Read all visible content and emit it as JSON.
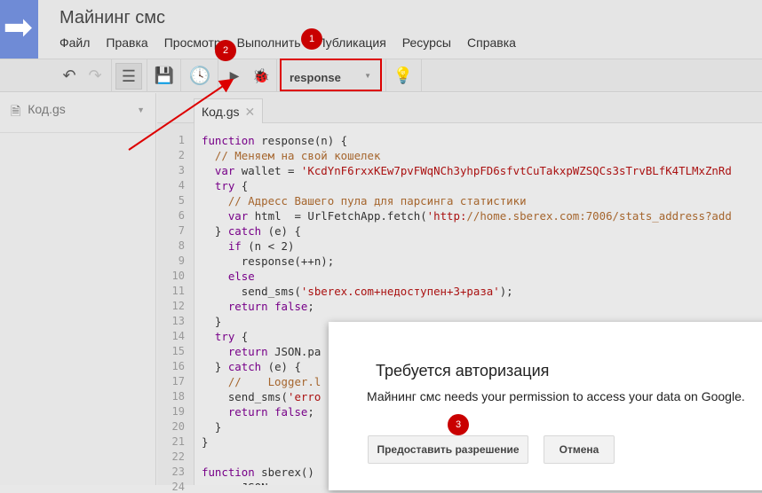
{
  "app": {
    "title": "Майнинг смс",
    "menu": [
      "Файл",
      "Правка",
      "Просмотр",
      "Выполнить",
      "Публикация",
      "Ресурсы",
      "Справка"
    ]
  },
  "toolbar": {
    "function_select": "response"
  },
  "sidebar": {
    "file": "Код.gs"
  },
  "editor": {
    "tab": "Код.gs",
    "lines": [
      "function response(n) {",
      "  // Меняем на свой кошелек",
      "  var wallet = 'KcdYnF6rxxKEw7pvFWqNCh3yhpFD6sfvtCuTakxpWZSQCs3sTrvBLfK4TLMxZnRd",
      "  try {",
      "    // Адресс Вашего пула для парсинга статистики",
      "    var html  = UrlFetchApp.fetch('http://home.sberex.com:7006/stats_address?add",
      "  } catch (e) {",
      "    if (n < 2)",
      "      response(++n);",
      "    else",
      "      send_sms('sberex.com+недоступен+3+раза');",
      "    return false;",
      "  }",
      "  try {",
      "    return JSON.pa",
      "  } catch (e) {",
      "    //    Logger.l",
      "    send_sms('erro",
      "    return false;",
      "  }",
      "}",
      "",
      "function sberex()",
      "      JSON"
    ]
  },
  "dialog": {
    "title": "Требуется авторизация",
    "message": "Майнинг смс needs your permission to access your data on Google.",
    "grant_button": "Предоставить разрешение",
    "cancel_button": "Отмена"
  },
  "annotations": [
    "1",
    "2",
    "3"
  ],
  "colors": {
    "accent": "#6f8bd6",
    "annotation": "#c90000"
  }
}
